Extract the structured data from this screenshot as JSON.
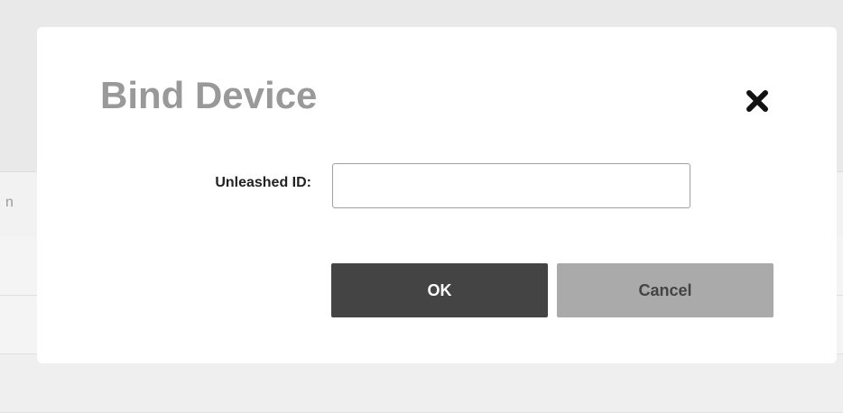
{
  "background": {
    "column_header_fragment": "n"
  },
  "dialog": {
    "title": "Bind Device",
    "close_icon": "close-x-icon",
    "field": {
      "label": "Unleashed ID:",
      "value": "",
      "placeholder": ""
    },
    "buttons": {
      "ok_label": "OK",
      "cancel_label": "Cancel"
    }
  },
  "colors": {
    "title": "#999999",
    "ok_button": "#444444",
    "cancel_button": "#aaaaaa",
    "overlay": "#ececec"
  }
}
